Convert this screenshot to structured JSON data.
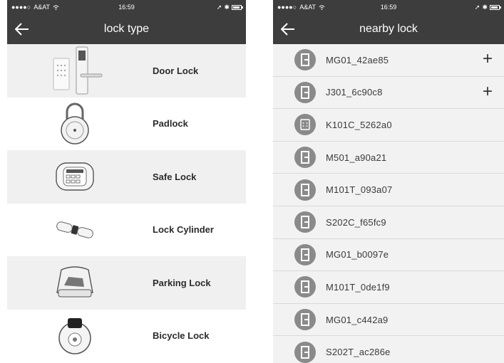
{
  "left_screen": {
    "status": {
      "carrier": "A&AT",
      "time": "16:59"
    },
    "title": "lock type",
    "lock_types": [
      {
        "label": "Door Lock",
        "icon": "door-lock-icon"
      },
      {
        "label": "Padlock",
        "icon": "padlock-icon"
      },
      {
        "label": "Safe Lock",
        "icon": "safe-lock-icon"
      },
      {
        "label": "Lock Cylinder",
        "icon": "lock-cylinder-icon"
      },
      {
        "label": "Parking Lock",
        "icon": "parking-lock-icon"
      },
      {
        "label": "Bicycle Lock",
        "icon": "bicycle-lock-icon"
      }
    ]
  },
  "right_screen": {
    "status": {
      "carrier": "A&AT",
      "time": "16:59"
    },
    "title": "nearby lock",
    "add_symbol": "+",
    "locks": [
      {
        "name": "MG01_42ae85",
        "icon": "door-lock-icon",
        "addable": true
      },
      {
        "name": "J301_6c90c8",
        "icon": "door-lock-icon",
        "addable": true
      },
      {
        "name": "K101C_5262a0",
        "icon": "keypad-lock-icon",
        "addable": false
      },
      {
        "name": "M501_a90a21",
        "icon": "door-lock-icon",
        "addable": false
      },
      {
        "name": "M101T_093a07",
        "icon": "door-lock-icon",
        "addable": false
      },
      {
        "name": "S202C_f65fc9",
        "icon": "door-lock-icon",
        "addable": false
      },
      {
        "name": "MG01_b0097e",
        "icon": "door-lock-icon",
        "addable": false
      },
      {
        "name": "M101T_0de1f9",
        "icon": "door-lock-icon",
        "addable": false
      },
      {
        "name": "MG01_c442a9",
        "icon": "door-lock-icon",
        "addable": false
      },
      {
        "name": "S202T_ac286e",
        "icon": "door-lock-icon",
        "addable": false
      }
    ]
  },
  "colors": {
    "navbar": "#3d3d3d",
    "avatar": "#8a8a8a",
    "row_shade": "#f0f0f0"
  }
}
